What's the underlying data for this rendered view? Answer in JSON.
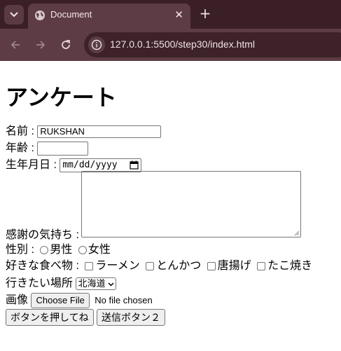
{
  "browser": {
    "tab_title": "Document",
    "tab_close": "✕",
    "new_tab": "+",
    "url": "127.0.0.1:5500/step30/index.html"
  },
  "page": {
    "title": "アンケート",
    "name_label": "名前 :",
    "name_value": "RUKSHAN",
    "age_label": "年齢 :",
    "birthday_label": "生年月日 :",
    "birthday_placeholder": "mm/dd/yyyy",
    "thanks_label": "感謝の気持ち :",
    "gender_label": "性別 :",
    "gender_options": [
      "男性",
      "女性"
    ],
    "food_label": "好きな食べ物 :",
    "food_options": [
      "ラーメン",
      "とんかつ",
      "唐揚げ",
      "たこ焼き"
    ],
    "place_label": "行きたい場所",
    "place_selected": "北海道",
    "image_label": "画像",
    "file_button": "Choose File",
    "file_status": "No file chosen",
    "button1": "ボタンを押してね",
    "button2": "送信ボタン２"
  }
}
